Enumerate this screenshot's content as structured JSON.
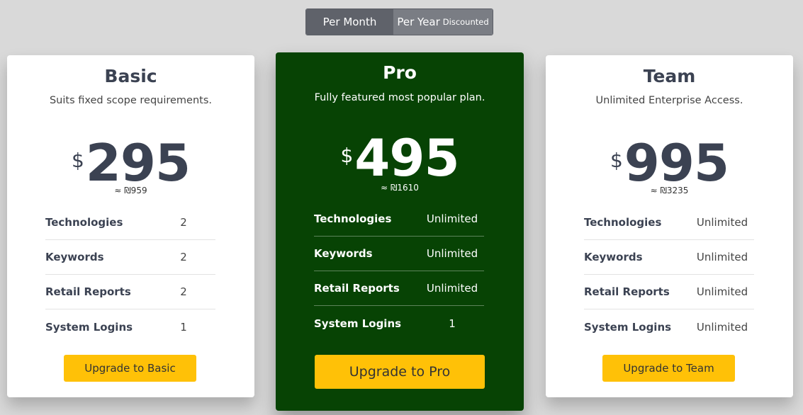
{
  "billing_toggle": {
    "month_label": "Per Month",
    "year_label": "Per Year",
    "year_badge": "Discounted"
  },
  "plans": [
    {
      "name": "Basic",
      "tagline": "Suits fixed scope requirements.",
      "currency": "$",
      "price": "295",
      "approx": "≈ ₪959",
      "features": [
        {
          "label": "Technologies",
          "value": "2"
        },
        {
          "label": "Keywords",
          "value": "2"
        },
        {
          "label": "Retail Reports",
          "value": "2"
        },
        {
          "label": "System Logins",
          "value": "1"
        }
      ],
      "button": "Upgrade to Basic"
    },
    {
      "name": "Pro",
      "tagline": "Fully featured most popular plan.",
      "currency": "$",
      "price": "495",
      "approx": "≈ ₪1610",
      "features": [
        {
          "label": "Technologies",
          "value": "Unlimited"
        },
        {
          "label": "Keywords",
          "value": "Unlimited"
        },
        {
          "label": "Retail Reports",
          "value": "Unlimited"
        },
        {
          "label": "System Logins",
          "value": "1"
        }
      ],
      "button": "Upgrade to Pro"
    },
    {
      "name": "Team",
      "tagline": "Unlimited Enterprise Access.",
      "currency": "$",
      "price": "995",
      "approx": "≈ ₪3235",
      "features": [
        {
          "label": "Technologies",
          "value": "Unlimited"
        },
        {
          "label": "Keywords",
          "value": "Unlimited"
        },
        {
          "label": "Retail Reports",
          "value": "Unlimited"
        },
        {
          "label": "System Logins",
          "value": "Unlimited"
        }
      ],
      "button": "Upgrade to Team"
    }
  ],
  "colors": {
    "background": "#d9d9d9",
    "pro_card": "#074304",
    "button": "#ffc107",
    "toggle_active": "#5f626a",
    "toggle_inactive": "#7a7d84"
  }
}
